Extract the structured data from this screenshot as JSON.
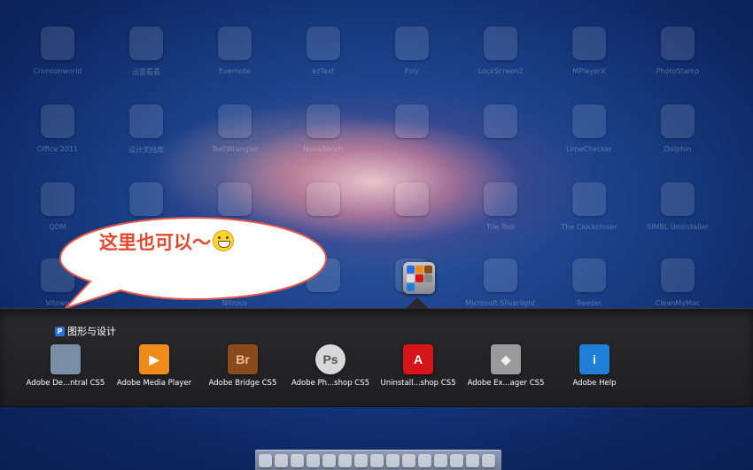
{
  "background_apps": [
    {
      "label": "Crimsonworld"
    },
    {
      "label": "迅雷看看"
    },
    {
      "label": "Evernote"
    },
    {
      "label": "ezText"
    },
    {
      "label": "Foly"
    },
    {
      "label": "LockScreen2"
    },
    {
      "label": "MPlayerX"
    },
    {
      "label": "PhotoStamp"
    },
    {
      "label": "Office 2011"
    },
    {
      "label": "设计文档库"
    },
    {
      "label": "TextWrangler"
    },
    {
      "label": "NovaBench"
    },
    {
      "label": ""
    },
    {
      "label": ""
    },
    {
      "label": "LimeChecker"
    },
    {
      "label": "Dolphin"
    },
    {
      "label": "QDM"
    },
    {
      "label": ""
    },
    {
      "label": ""
    },
    {
      "label": ""
    },
    {
      "label": ""
    },
    {
      "label": "Tile Tool"
    },
    {
      "label": "The Clockchiser"
    },
    {
      "label": "SIMBL Uninstaller"
    },
    {
      "label": "Vitowa"
    },
    {
      "label": ""
    },
    {
      "label": "Nitrous"
    },
    {
      "label": ""
    },
    {
      "label": ""
    },
    {
      "label": "Microsoft Silverlight"
    },
    {
      "label": "Reeder"
    },
    {
      "label": "CleanMyMac"
    }
  ],
  "bubble": {
    "text": "这里也可以～"
  },
  "folder": {
    "badge": "P",
    "title": "图形与设计",
    "apps": [
      {
        "label": "Adobe De...ntral CS5",
        "icon": "device-central-icon",
        "glyph": "",
        "bg": "#7a8ea8",
        "fg": "#fff"
      },
      {
        "label": "Adobe Media Player",
        "icon": "media-player-icon",
        "glyph": "▶",
        "bg": "#f08a1a",
        "fg": "#fff"
      },
      {
        "label": "Adobe Bridge CS5",
        "icon": "bridge-icon",
        "glyph": "Br",
        "bg": "#8a4a1a",
        "fg": "#f5c090"
      },
      {
        "label": "Adobe Ph...shop CS5",
        "icon": "photoshop-icon",
        "glyph": "Ps",
        "bg": "#d8d8d8",
        "fg": "#555"
      },
      {
        "label": "Uninstall...shop CS5",
        "icon": "adobe-uninstaller-icon",
        "glyph": "A",
        "bg": "#d6141a",
        "fg": "#fff"
      },
      {
        "label": "Adobe Ex...ager CS5",
        "icon": "extension-manager-icon",
        "glyph": "◆",
        "bg": "#9a9a9a",
        "fg": "#eee"
      },
      {
        "label": "Adobe Help",
        "icon": "info-icon",
        "glyph": "i",
        "bg": "#1f7fd8",
        "fg": "#fff"
      }
    ]
  }
}
